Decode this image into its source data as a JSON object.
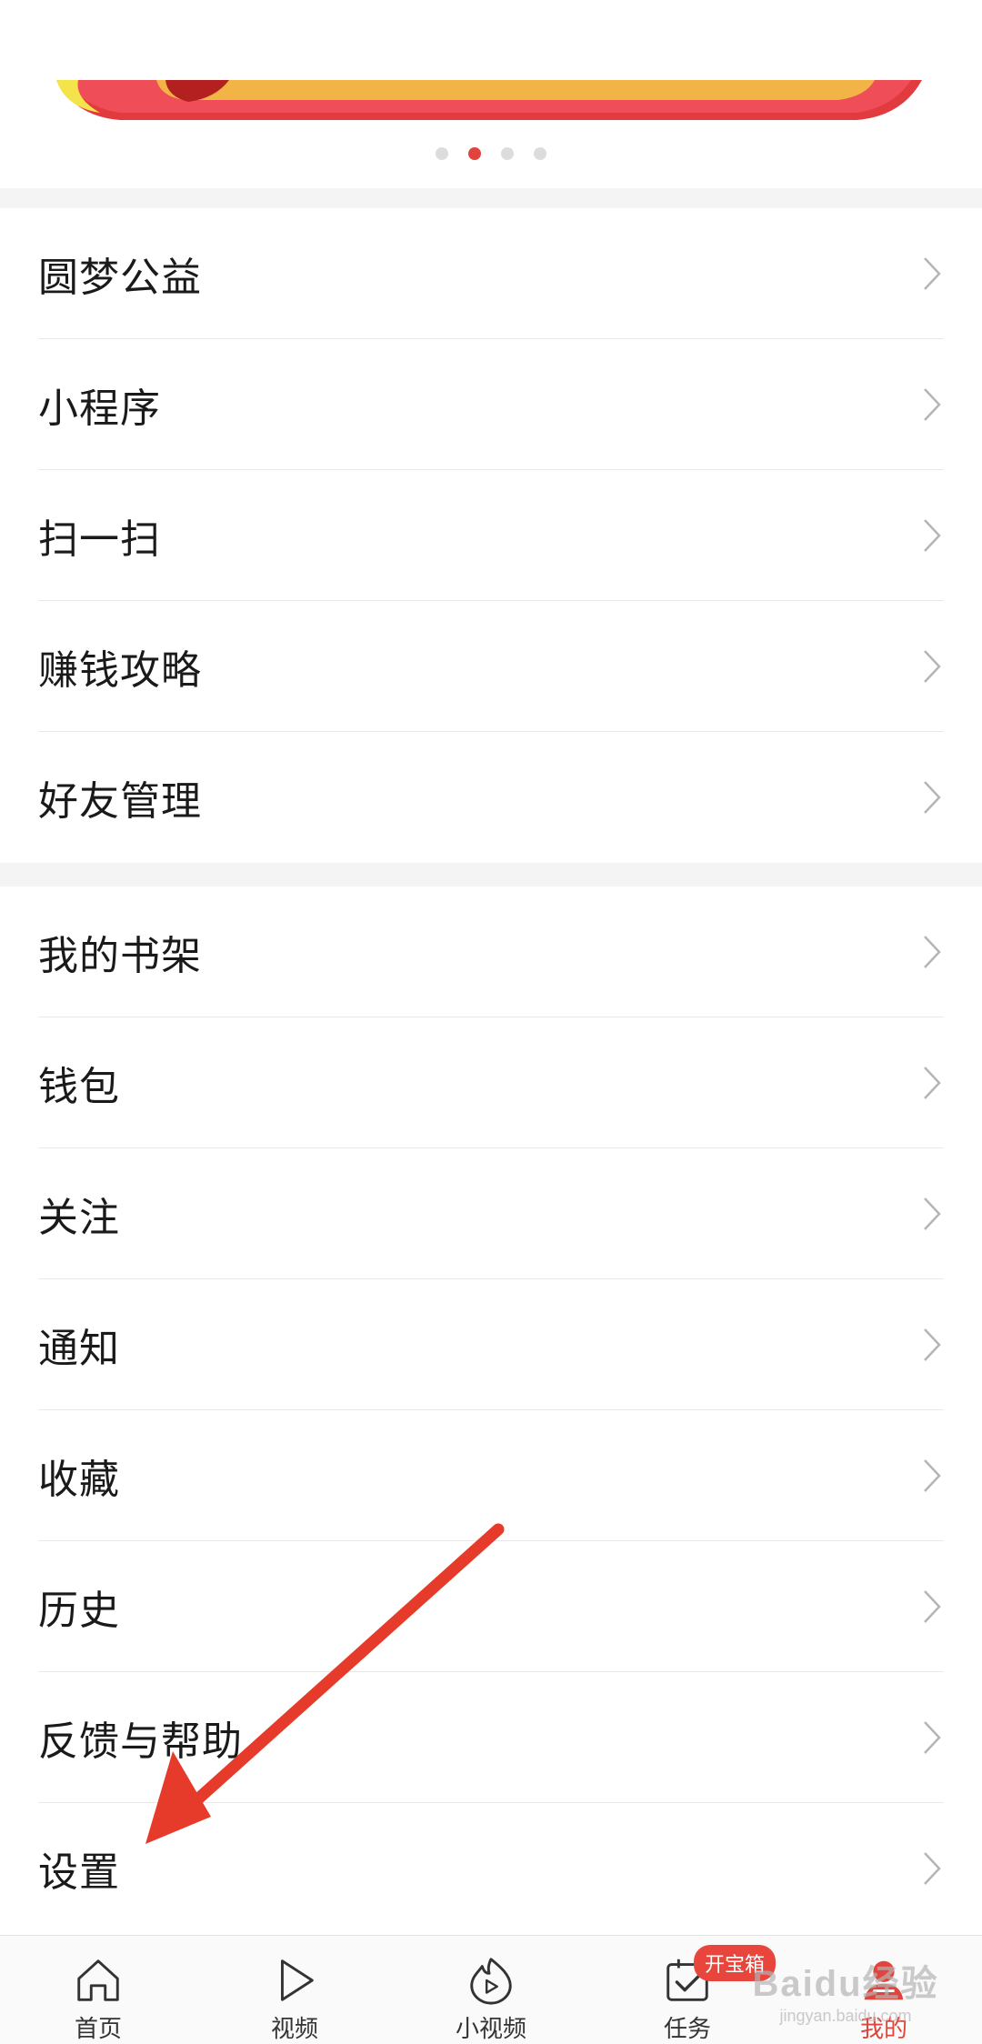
{
  "banner": {
    "dot_count": 4,
    "active_index": 1
  },
  "menu_group_1": [
    {
      "label": "圆梦公益"
    },
    {
      "label": "小程序"
    },
    {
      "label": "扫一扫"
    },
    {
      "label": "赚钱攻略"
    },
    {
      "label": "好友管理"
    }
  ],
  "menu_group_2": [
    {
      "label": "我的书架"
    },
    {
      "label": "钱包"
    },
    {
      "label": "关注"
    },
    {
      "label": "通知"
    },
    {
      "label": "收藏"
    },
    {
      "label": "历史"
    },
    {
      "label": "反馈与帮助"
    },
    {
      "label": "设置"
    }
  ],
  "tabbar": {
    "tabs": [
      {
        "label": "首页",
        "icon": "home-icon"
      },
      {
        "label": "视频",
        "icon": "play-icon"
      },
      {
        "label": "小视频",
        "icon": "flame-play-icon"
      },
      {
        "label": "任务",
        "icon": "task-check-icon",
        "badge": "开宝箱"
      },
      {
        "label": "我的",
        "icon": "user-icon",
        "active": true
      }
    ]
  },
  "watermark": {
    "brand": "Baidu经验",
    "url": "jingyan.baidu.com"
  },
  "colors": {
    "accent": "#e0443c",
    "annotation_arrow": "#e63a2a",
    "section_gap": "#f4f4f4"
  }
}
